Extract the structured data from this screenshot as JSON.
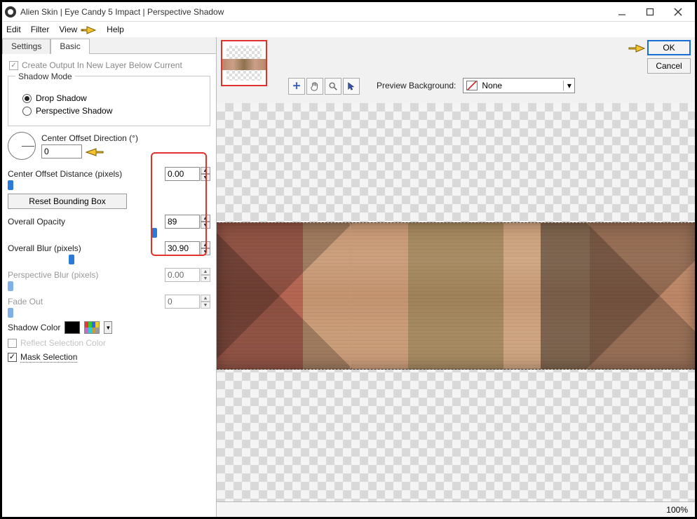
{
  "window": {
    "title": "Alien Skin | Eye Candy 5 Impact | Perspective Shadow"
  },
  "menu": {
    "edit": "Edit",
    "filter": "Filter",
    "view": "View",
    "help": "Help"
  },
  "tabs": {
    "settings": "Settings",
    "basic": "Basic"
  },
  "panel": {
    "create_output": "Create Output In New Layer Below Current",
    "shadow_mode_legend": "Shadow Mode",
    "drop_shadow": "Drop Shadow",
    "perspective_shadow": "Perspective Shadow",
    "center_offset_dir_label": "Center Offset Direction (°)",
    "center_offset_dir_value": "0",
    "center_offset_dist_label": "Center Offset Distance (pixels)",
    "center_offset_dist_value": "0.00",
    "reset_bb": "Reset Bounding Box",
    "overall_opacity_label": "Overall Opacity",
    "overall_opacity_value": "89",
    "overall_blur_label": "Overall Blur (pixels)",
    "overall_blur_value": "30.90",
    "perspective_blur_label": "Perspective Blur (pixels)",
    "perspective_blur_value": "0.00",
    "fade_out_label": "Fade Out",
    "fade_out_value": "0",
    "shadow_color_label": "Shadow Color",
    "reflect_sel_label": "Reflect Selection Color",
    "mask_sel_label": "Mask Selection"
  },
  "toolbar": {
    "preview_bg_label": "Preview Background:",
    "preview_bg_value": "None",
    "ok": "OK",
    "cancel": "Cancel"
  },
  "status": {
    "zoom": "100%"
  },
  "icons": {
    "move": "move-icon",
    "hand": "hand-icon",
    "zoom": "zoom-icon",
    "arrow": "arrow-icon"
  }
}
